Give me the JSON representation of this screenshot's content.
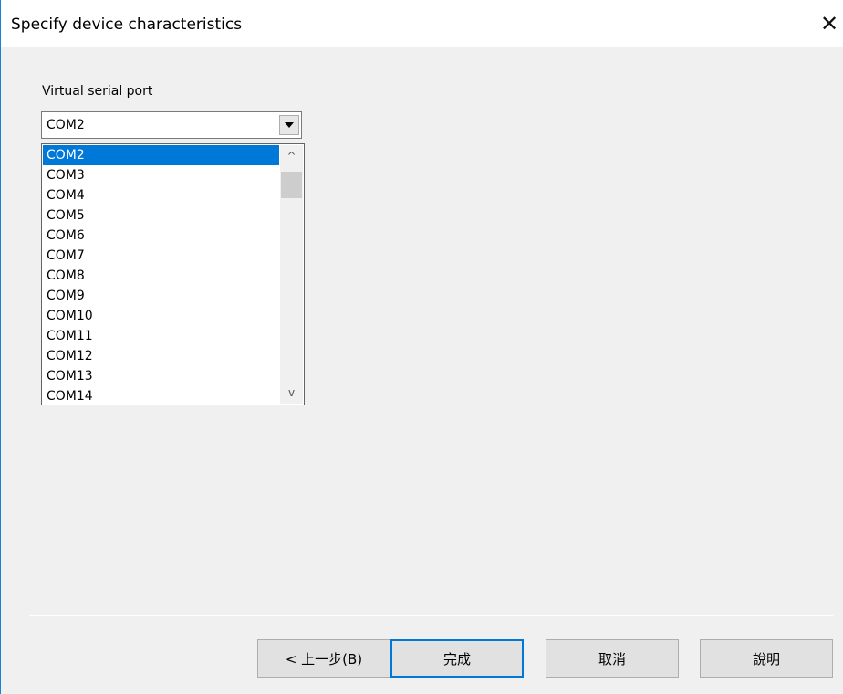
{
  "window": {
    "title": "Specify device characteristics",
    "close_label": "✕"
  },
  "port_field": {
    "label": "Virtual serial port",
    "selected_value": "COM2",
    "options": [
      "COM2",
      "COM3",
      "COM4",
      "COM5",
      "COM6",
      "COM7",
      "COM8",
      "COM9",
      "COM10",
      "COM11",
      "COM12",
      "COM13",
      "COM14"
    ]
  },
  "scrollbar": {
    "up_icon": "^",
    "down_icon": "v"
  },
  "buttons": {
    "back": "< 上一步(B)",
    "finish": "完成",
    "cancel": "取消",
    "help": "說明"
  },
  "colors": {
    "selection": "#0078d7",
    "window_border": "#1e7fd6"
  }
}
